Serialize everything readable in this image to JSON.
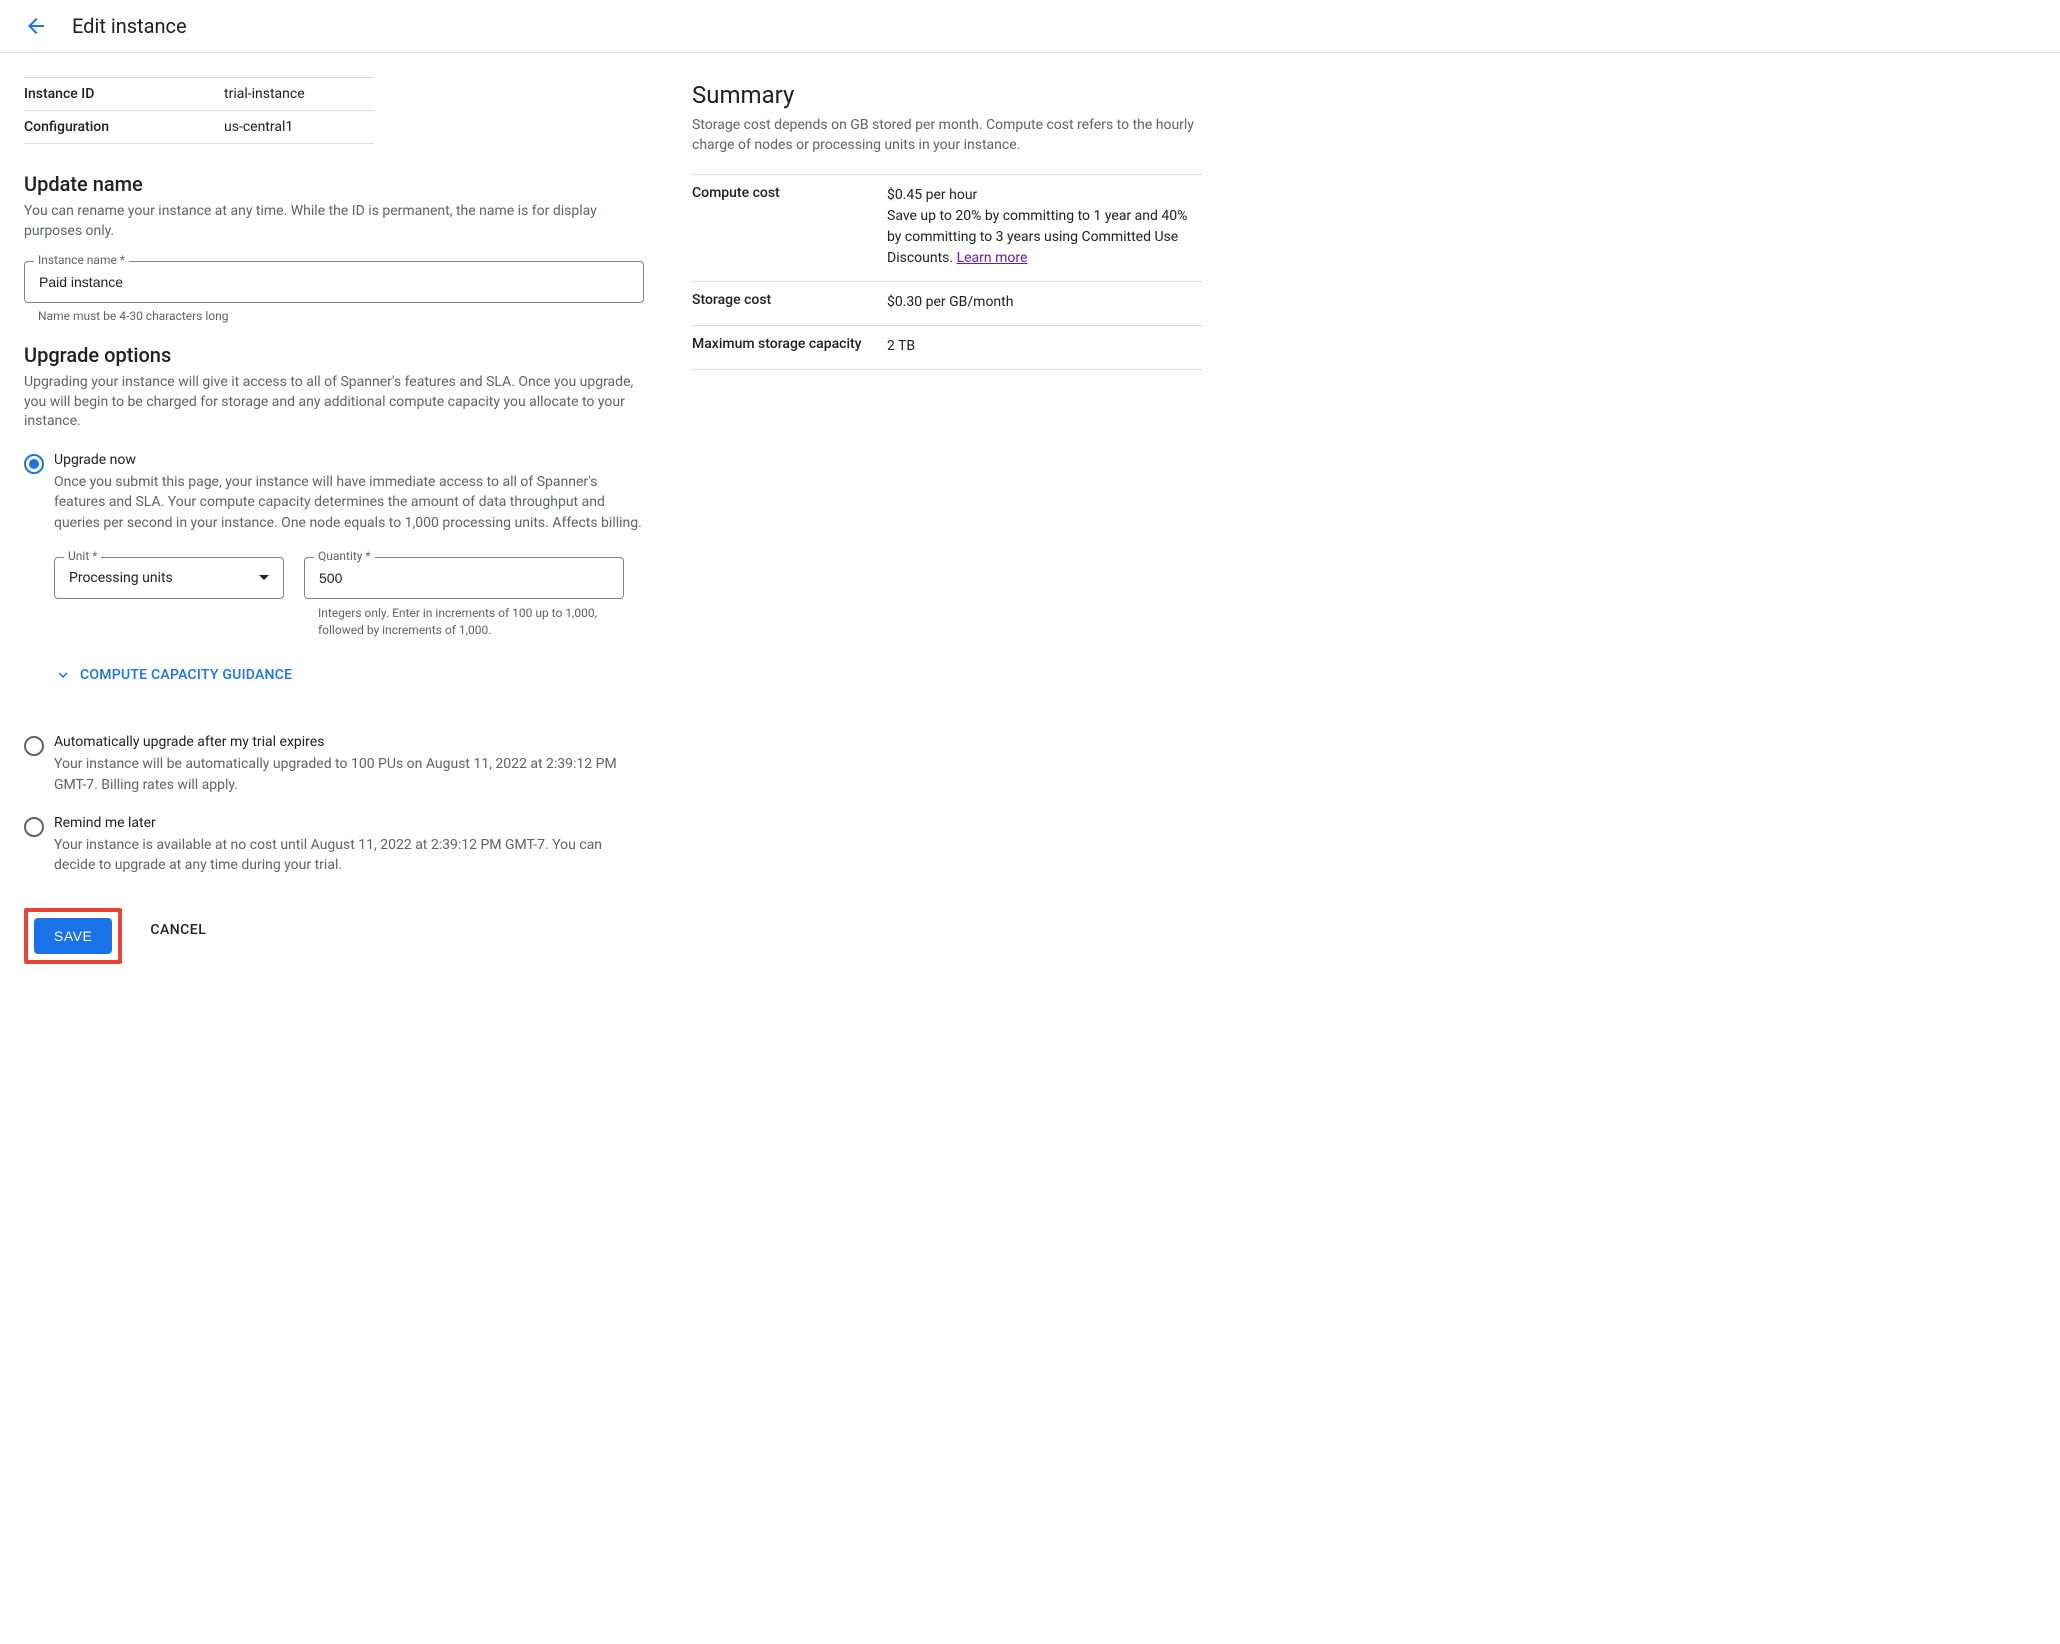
{
  "header": {
    "title": "Edit instance"
  },
  "meta": {
    "instance_id_label": "Instance ID",
    "instance_id_value": "trial-instance",
    "configuration_label": "Configuration",
    "configuration_value": "us-central1"
  },
  "update_name": {
    "title": "Update name",
    "desc": "You can rename your instance at any time. While the ID is permanent, the name is for display purposes only.",
    "field_label": "Instance name *",
    "field_value": "Paid instance",
    "helper": "Name must be 4-30 characters long"
  },
  "upgrade": {
    "title": "Upgrade options",
    "desc": "Upgrading your instance will give it access to all of Spanner's features and SLA. Once you upgrade, you will begin to be charged for storage and any additional compute capacity you allocate to your instance.",
    "options": [
      {
        "label": "Upgrade now",
        "desc": "Once you submit this page, your instance will have immediate access to all of Spanner's features and SLA. Your compute capacity determines the amount of data throughput and queries per second in your instance. One node equals to 1,000 processing units. Affects billing."
      },
      {
        "label": "Automatically upgrade after my trial expires",
        "desc": "Your instance will be automatically upgraded to 100 PUs on August 11, 2022 at 2:39:12 PM GMT-7. Billing rates will apply."
      },
      {
        "label": "Remind me later",
        "desc": "Your instance is available at no cost until August 11, 2022 at 2:39:12 PM GMT-7. You can decide to upgrade at any time during your trial."
      }
    ],
    "unit_label": "Unit *",
    "unit_value": "Processing units",
    "quantity_label": "Quantity *",
    "quantity_value": "500",
    "quantity_helper": "Integers only. Enter in increments of 100 up to 1,000, followed by increments of 1,000.",
    "compute_guidance": "COMPUTE CAPACITY GUIDANCE"
  },
  "buttons": {
    "save": "SAVE",
    "cancel": "CANCEL"
  },
  "summary": {
    "title": "Summary",
    "desc": "Storage cost depends on GB stored per month. Compute cost refers to the hourly charge of nodes or processing units in your instance.",
    "compute_label": "Compute cost",
    "compute_value": "$0.45 per hour",
    "compute_extra": "Save up to 20% by committing to 1 year and 40% by committing to 3 years using Committed Use Discounts. ",
    "learn_more": "Learn more",
    "storage_label": "Storage cost",
    "storage_value": "$0.30 per GB/month",
    "max_storage_label": "Maximum storage capacity",
    "max_storage_value": "2 TB"
  }
}
